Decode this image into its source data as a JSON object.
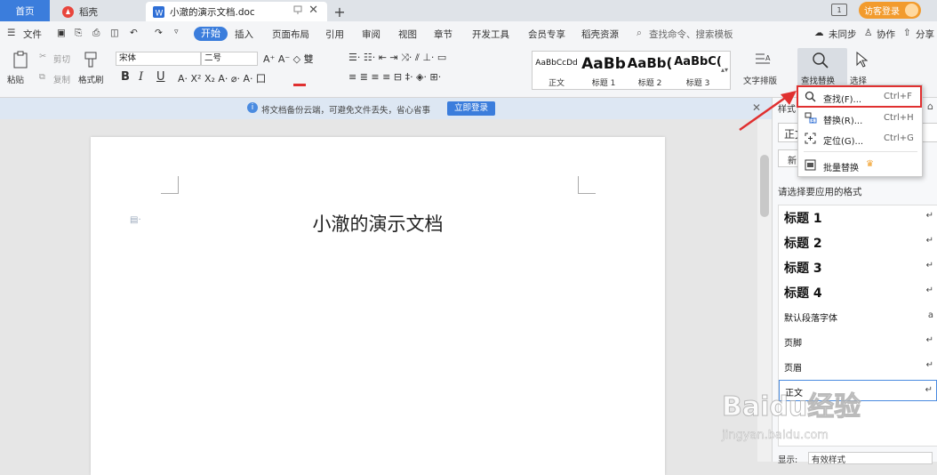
{
  "tabs": {
    "home": "首页",
    "daoke": "稻壳",
    "doc": "小澈的演示文档.doc",
    "add": "+",
    "pin": "☐"
  },
  "topright": {
    "screen": "1",
    "login": "访客登录"
  },
  "menu": {
    "file": "文件",
    "start": "开始",
    "insert": "插入",
    "layout": "页面布局",
    "ref": "引用",
    "review": "审阅",
    "view": "视图",
    "chapter": "章节",
    "dev": "开发工具",
    "vip": "会员专享",
    "resource": "稻壳资源",
    "search": "查找命令、搜索模板",
    "sync": "未同步",
    "collab": "协作",
    "share": "分享"
  },
  "ribbon": {
    "paste": "粘贴",
    "cut": "剪切",
    "copy": "复制",
    "format_painter": "格式刷",
    "font": "宋体",
    "size": "二号",
    "bold": "B",
    "italic": "I",
    "underline": "U",
    "styles": [
      {
        "preview": "AaBbCcDd",
        "name": "正文"
      },
      {
        "preview": "AaBb",
        "name": "标题 1"
      },
      {
        "preview": "AaBb(",
        "name": "标题 2"
      },
      {
        "preview": "AaBbC(",
        "name": "标题 3"
      }
    ],
    "text_layout": "文字排版",
    "find_replace": "查找替换",
    "select": "选择"
  },
  "infobar": {
    "text": "将文档备份云端，可避免文件丢失，省心省事",
    "login_now": "立即登录",
    "close": "✕"
  },
  "document": {
    "title": "小澈的演示文档"
  },
  "dropdown": {
    "items": [
      {
        "label": "查找(F)...",
        "shortcut": "Ctrl+F",
        "icon": "search-icon"
      },
      {
        "label": "替换(R)...",
        "shortcut": "Ctrl+H",
        "icon": "replace-icon"
      },
      {
        "label": "定位(G)...",
        "shortcut": "Ctrl+G",
        "icon": "locate-icon"
      },
      {
        "label": "批量替换",
        "shortcut": "",
        "icon": "batch-replace-icon"
      }
    ]
  },
  "style_panel": {
    "header": "样式",
    "current": "正文",
    "new": "新",
    "prompt": "请选择要应用的格式",
    "items": [
      "标题  1",
      "标题  2",
      "标题  3",
      "标题  4",
      "默认段落字体",
      "页脚",
      "页眉",
      "正文"
    ],
    "show_label": "显示:",
    "show_value": "有效样式"
  },
  "watermark": {
    "brand": "Baidu经验",
    "url": "jingyan.baidu.com"
  },
  "colors": {
    "accent": "#3b7ddc",
    "highlight": "#e03030",
    "login": "#f29b2d"
  }
}
